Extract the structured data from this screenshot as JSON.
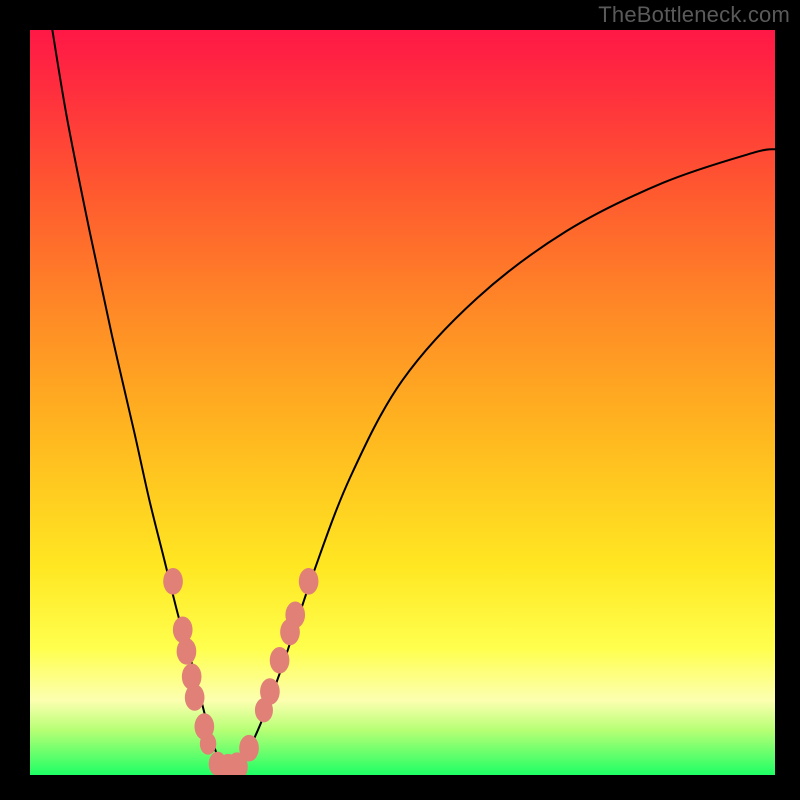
{
  "watermark": "TheBottleneck.com",
  "colors": {
    "frame": "#000000",
    "curve": "#000000",
    "marker_fill": "#e08076",
    "marker_stroke": "#c76a61",
    "gradient_top": "#ff1846",
    "gradient_bottom": "#1eff65"
  },
  "chart_data": {
    "type": "line",
    "title": "",
    "xlabel": "",
    "ylabel": "",
    "xlim": [
      0,
      100
    ],
    "ylim": [
      0,
      100
    ],
    "note": "Axis scales are relative (no tick labels in source image). y is plotted as distance from bottom (0 = green bottom, 100 = red top).",
    "series": [
      {
        "name": "bottleneck-curve",
        "x": [
          3,
          5,
          8,
          11,
          14,
          16,
          18,
          20,
          22,
          23.5,
          25,
          26,
          27.5,
          29,
          31,
          34,
          38,
          43,
          50,
          60,
          72,
          85,
          97,
          100
        ],
        "y": [
          100,
          88,
          73,
          59,
          46,
          37,
          29,
          21,
          14,
          8,
          3,
          1,
          1,
          2.8,
          7,
          15,
          27,
          40,
          53,
          64,
          73,
          79.5,
          83.5,
          84.0
        ]
      }
    ],
    "markers": [
      {
        "x": 19.2,
        "y": 26.0,
        "size": 2.4
      },
      {
        "x": 20.5,
        "y": 19.5,
        "size": 2.4
      },
      {
        "x": 21.0,
        "y": 16.6,
        "size": 2.4
      },
      {
        "x": 21.7,
        "y": 13.2,
        "size": 2.4
      },
      {
        "x": 22.1,
        "y": 10.4,
        "size": 2.4
      },
      {
        "x": 23.4,
        "y": 6.5,
        "size": 2.4
      },
      {
        "x": 23.9,
        "y": 4.2,
        "size": 2.0
      },
      {
        "x": 25.2,
        "y": 1.5,
        "size": 2.2
      },
      {
        "x": 26.6,
        "y": 0.9,
        "size": 2.6
      },
      {
        "x": 27.8,
        "y": 1.1,
        "size": 2.6
      },
      {
        "x": 29.4,
        "y": 3.6,
        "size": 2.4
      },
      {
        "x": 31.4,
        "y": 8.7,
        "size": 2.2
      },
      {
        "x": 32.2,
        "y": 11.2,
        "size": 2.4
      },
      {
        "x": 33.5,
        "y": 15.4,
        "size": 2.4
      },
      {
        "x": 34.9,
        "y": 19.2,
        "size": 2.4
      },
      {
        "x": 35.6,
        "y": 21.5,
        "size": 2.4
      },
      {
        "x": 37.4,
        "y": 26.0,
        "size": 2.4
      }
    ]
  }
}
